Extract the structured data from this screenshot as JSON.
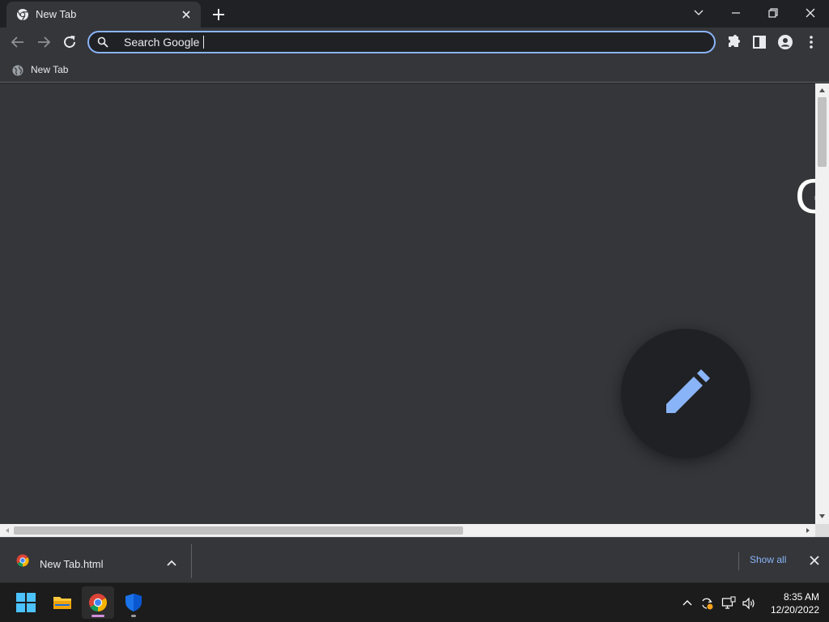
{
  "browser": {
    "tab": {
      "title": "New Tab"
    },
    "omnibox": {
      "text": "Search Google"
    },
    "bookmarks": [
      {
        "label": "New Tab",
        "icon": "globe-icon"
      }
    ],
    "page": {
      "logo_partial": "G"
    }
  },
  "download_shelf": {
    "item": {
      "filename": "New Tab.html",
      "icon": "chrome-icon"
    },
    "show_all": "Show all"
  },
  "taskbar": {
    "apps": [
      {
        "name": "start",
        "icon": "windows-start-icon"
      },
      {
        "name": "file-explorer",
        "icon": "folder-icon"
      },
      {
        "name": "chrome",
        "icon": "chrome-icon"
      },
      {
        "name": "security",
        "icon": "shield-icon"
      }
    ],
    "clock": {
      "time": "8:35 AM",
      "date": "12/20/2022"
    }
  },
  "colors": {
    "accent": "#8ab4f8",
    "toolbar": "#35363a",
    "frame": "#202124"
  }
}
